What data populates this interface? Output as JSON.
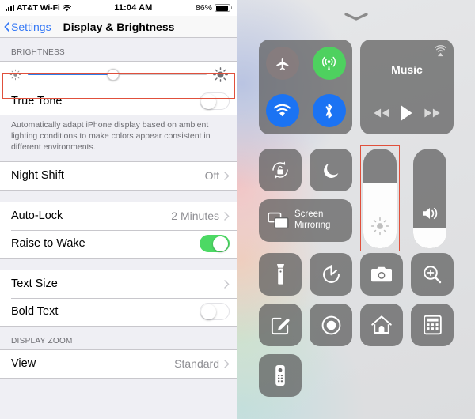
{
  "settings": {
    "status_bar": {
      "signal_icon": "cellular-signal-icon",
      "carrier": "AT&T Wi-Fi",
      "wifi_icon": "wifi-icon",
      "time": "11:04 AM",
      "battery_percent": "86%",
      "battery_icon": "battery-icon"
    },
    "nav": {
      "back_icon": "chevron-left-icon",
      "back_label": "Settings",
      "title": "Display & Brightness"
    },
    "brightness": {
      "header": "BRIGHTNESS",
      "low_icon": "brightness-low-icon",
      "high_icon": "brightness-high-icon",
      "value_percent": 48,
      "highlighted": true
    },
    "true_tone": {
      "label": "True Tone",
      "enabled": false,
      "footer": "Automatically adapt iPhone display based on ambient lighting conditions to make colors appear consistent in different environments."
    },
    "night_shift": {
      "label": "Night Shift",
      "value": "Off",
      "chevron_icon": "chevron-right-icon"
    },
    "auto_lock": {
      "label": "Auto-Lock",
      "value": "2 Minutes",
      "chevron_icon": "chevron-right-icon"
    },
    "raise_to_wake": {
      "label": "Raise to Wake",
      "enabled": true
    },
    "text_size": {
      "label": "Text Size",
      "chevron_icon": "chevron-right-icon"
    },
    "bold_text": {
      "label": "Bold Text",
      "enabled": false
    },
    "display_zoom": {
      "header": "DISPLAY ZOOM",
      "view_label": "View",
      "view_value": "Standard",
      "chevron_icon": "chevron-right-icon"
    },
    "highlight_color": "#e0503c"
  },
  "control_center": {
    "grabber_icon": "chevron-down-icon",
    "connectivity": [
      {
        "name": "airplane-mode-toggle",
        "icon": "airplane-icon",
        "state": "off",
        "color": "#8c7d7d"
      },
      {
        "name": "cellular-data-toggle",
        "icon": "cellular-icon",
        "state": "on",
        "color": "#4ed15f"
      },
      {
        "name": "wifi-toggle",
        "icon": "wifi-icon",
        "state": "on",
        "color": "#1b73f3"
      },
      {
        "name": "bluetooth-toggle",
        "icon": "bluetooth-icon",
        "state": "on",
        "color": "#1b73f3"
      }
    ],
    "music": {
      "title": "Music",
      "airplay_icon": "airplay-icon",
      "prev_icon": "rewind-icon",
      "play_icon": "play-icon",
      "next_icon": "fast-forward-icon"
    },
    "rotation_lock": {
      "label": "rotation-lock",
      "icon": "rotation-lock-icon",
      "state": "off"
    },
    "do_not_disturb": {
      "label": "do-not-disturb",
      "icon": "moon-icon",
      "state": "off"
    },
    "screen_mirroring": {
      "label_line1": "Screen",
      "label_line2": "Mirroring",
      "icon": "screen-mirroring-icon"
    },
    "brightness_slider": {
      "icon": "brightness-icon",
      "value_percent": 66,
      "highlighted": true
    },
    "volume_slider": {
      "icon": "speaker-icon",
      "value_percent": 21,
      "highlighted": false
    },
    "shortcuts": [
      {
        "name": "flashlight-button",
        "icon": "flashlight-icon"
      },
      {
        "name": "timer-button",
        "icon": "timer-icon"
      },
      {
        "name": "camera-button",
        "icon": "camera-icon"
      },
      {
        "name": "magnifier-button",
        "icon": "magnifier-icon"
      },
      {
        "name": "notes-button",
        "icon": "notes-icon"
      },
      {
        "name": "screen-record-button",
        "icon": "screen-record-icon"
      },
      {
        "name": "home-button",
        "icon": "home-icon"
      },
      {
        "name": "calculator-button",
        "icon": "calculator-icon"
      },
      {
        "name": "apple-tv-remote-button",
        "icon": "remote-icon"
      }
    ]
  }
}
